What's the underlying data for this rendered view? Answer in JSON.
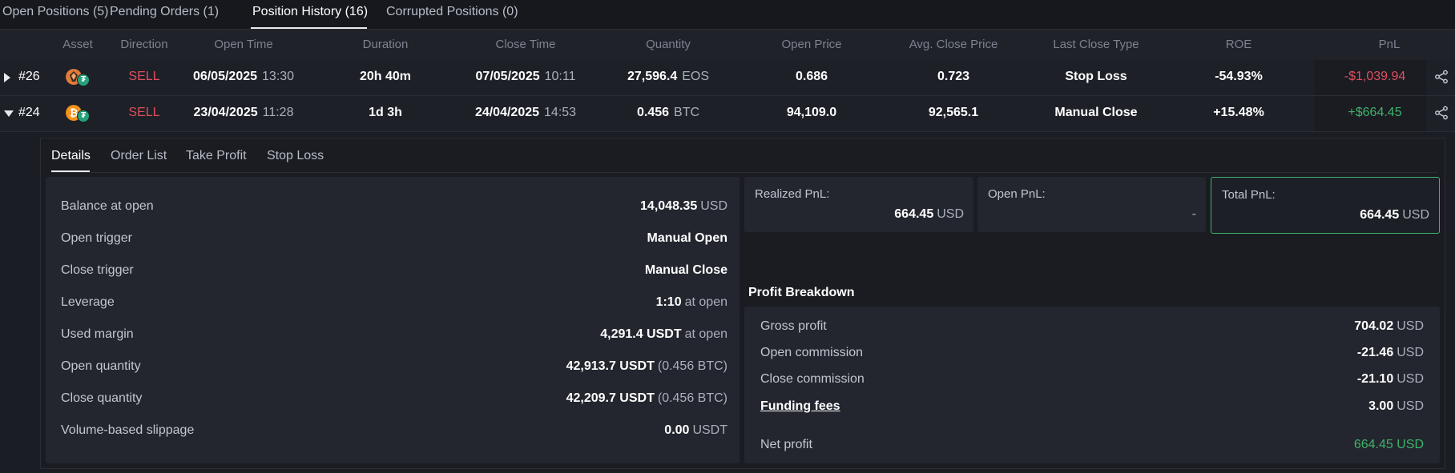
{
  "tabs": [
    {
      "label": "Open Positions (5)"
    },
    {
      "label": "Pending Orders (1)"
    },
    {
      "label": "Position History (16)"
    },
    {
      "label": "Corrupted Positions (0)"
    }
  ],
  "active_tab": "Position History (16)",
  "columns": [
    "Asset",
    "Direction",
    "Open Time",
    "Duration",
    "Close Time",
    "Quantity",
    "Open Price",
    "Avg. Close Price",
    "Last Close Type",
    "ROE",
    "PnL"
  ],
  "rows": [
    {
      "id": "#26",
      "asset_icon": "eos-coin-icon",
      "direction": "SELL",
      "open_date": "06/05/2025",
      "open_time": "13:30",
      "duration": "20h 40m",
      "close_date": "07/05/2025",
      "close_time": "10:11",
      "quantity": "27,596.4",
      "quantity_unit": "EOS",
      "open_price": "0.686",
      "avg_close_price": "0.723",
      "last_close_type": "Stop Loss",
      "roe": "-54.93%",
      "pnl": "-$1,039.94",
      "expanded": false
    },
    {
      "id": "#24",
      "asset_icon": "btc-coin-icon",
      "direction": "SELL",
      "open_date": "23/04/2025",
      "open_time": "11:28",
      "duration": "1d 3h",
      "close_date": "24/04/2025",
      "close_time": "14:53",
      "quantity": "0.456",
      "quantity_unit": "BTC",
      "open_price": "94,109.0",
      "avg_close_price": "92,565.1",
      "last_close_type": "Manual Close",
      "roe": "+15.48%",
      "pnl": "+$664.45",
      "expanded": true
    }
  ],
  "detail": {
    "tabs": [
      "Details",
      "Order List",
      "Take Profit",
      "Stop Loss"
    ],
    "active_tab": "Details",
    "info": [
      {
        "label": "Balance at open",
        "value": "14,048.35",
        "unit": "USD"
      },
      {
        "label": "Open trigger",
        "value": "Manual Open",
        "unit": ""
      },
      {
        "label": "Close trigger",
        "value": "Manual Close",
        "unit": ""
      },
      {
        "label": "Leverage",
        "value": "1:10",
        "unit": "at open"
      },
      {
        "label": "Used margin",
        "value": "4,291.4 USDT",
        "unit": "at open"
      },
      {
        "label": "Open quantity",
        "value": "42,913.7 USDT",
        "unit": "(0.456 BTC)"
      },
      {
        "label": "Close quantity",
        "value": "42,209.7 USDT",
        "unit": "(0.456 BTC)"
      },
      {
        "label": "Volume-based slippage",
        "value": "0.00",
        "unit": "USDT"
      }
    ],
    "cards": {
      "realized": {
        "label": "Realized PnL:",
        "value": "664.45",
        "unit": "USD"
      },
      "open": {
        "label": "Open PnL:",
        "value": "-"
      },
      "total": {
        "label": "Total PnL:",
        "value": "664.45",
        "unit": "USD"
      }
    },
    "profit_breakdown": {
      "title": "Profit Breakdown",
      "rows": [
        {
          "label": "Gross profit",
          "value": "704.02",
          "unit": "USD"
        },
        {
          "label": "Open commission",
          "value": "-21.46",
          "unit": "USD"
        },
        {
          "label": "Close commission",
          "value": "-21.10",
          "unit": "USD"
        },
        {
          "label": "Funding fees",
          "value": "3.00",
          "unit": "USD"
        }
      ],
      "net": {
        "label": "Net profit",
        "value": "664.45 USD"
      }
    }
  },
  "colors": {
    "sell": "#e04f5f",
    "loss": "#e04f5f",
    "profit": "#3fb46a",
    "total_border": "#3fb46a"
  }
}
